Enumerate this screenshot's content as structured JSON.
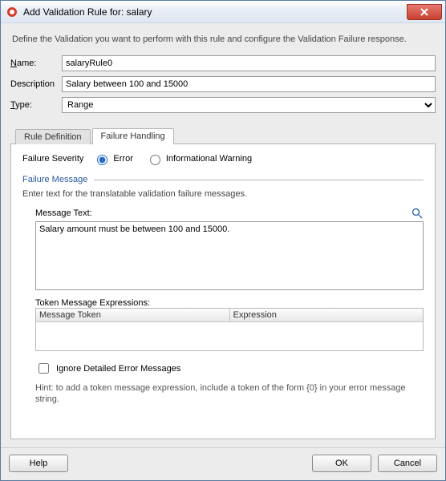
{
  "titlebar": {
    "title": "Add Validation Rule for: salary"
  },
  "instruction": "Define the Validation you want to perform with this rule and configure the Validation Failure response.",
  "form": {
    "name_label": "Name:",
    "name_value": "salaryRule0",
    "desc_label": "Description",
    "desc_value": "Salary between 100 and 15000",
    "type_label": "Type:",
    "type_value": "Range"
  },
  "tabs": {
    "rule_def": "Rule Definition",
    "failure": "Failure Handling"
  },
  "severity": {
    "label": "Failure Severity",
    "error": "Error",
    "warning": "Informational Warning"
  },
  "failure_msg": {
    "header": "Failure Message",
    "sub": "Enter text for the translatable validation failure messages.",
    "msg_label": "Message Text:",
    "msg_text": "Salary amount must be between 100 and 15000.",
    "tok_label": "Token Message Expressions:",
    "tok_col1": "Message Token",
    "tok_col2": "Expression",
    "ignore": "Ignore Detailed Error Messages",
    "hint": "Hint: to add a token message expression, include a token of the form {0} in your error message string."
  },
  "footer": {
    "help": "Help",
    "ok": "OK",
    "cancel": "Cancel"
  }
}
